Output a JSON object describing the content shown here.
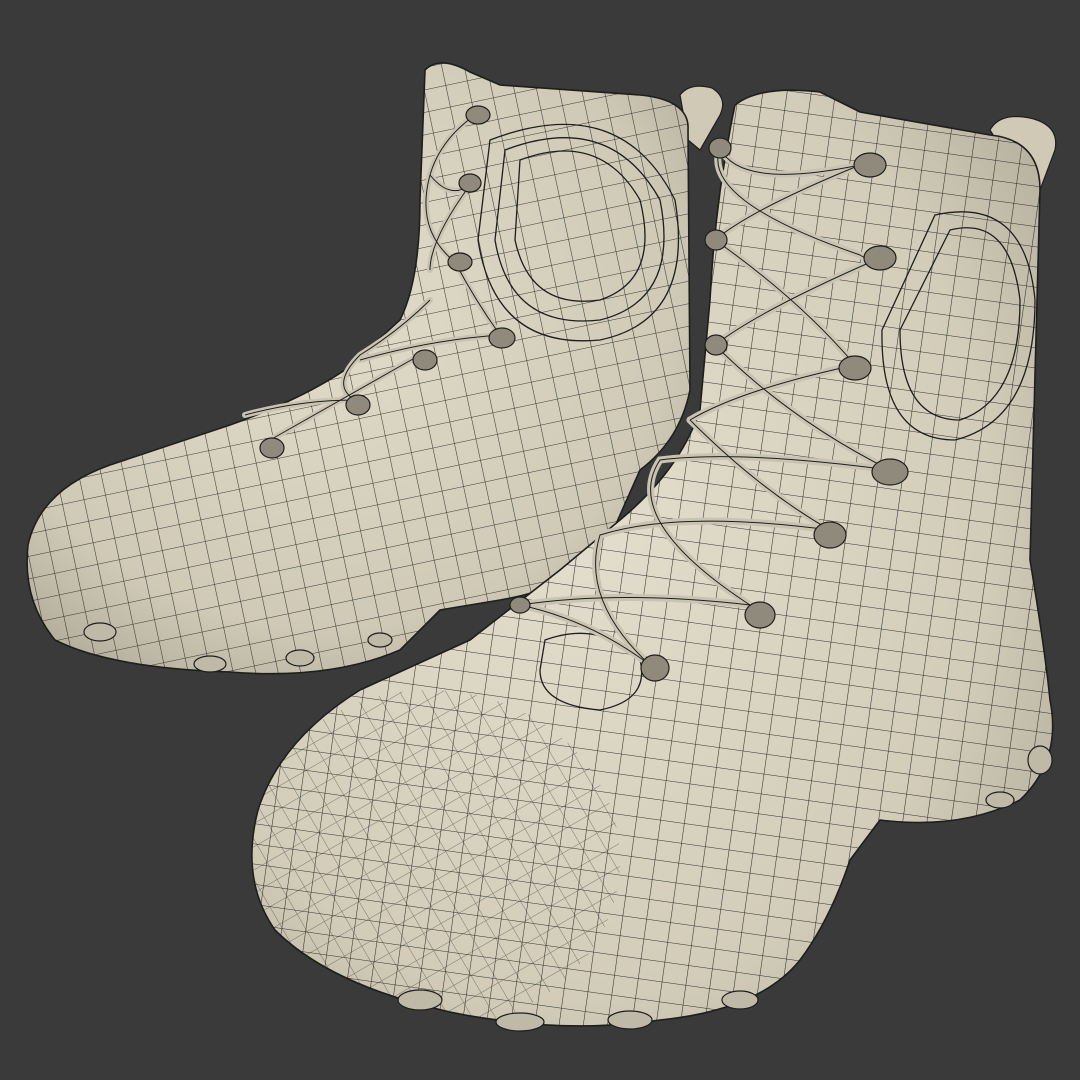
{
  "viewport": {
    "background": "#3a3a3a",
    "model_color": "#d6d1c0",
    "model_shade": "#a8a392",
    "wire_color": "#1e1e1c",
    "lace_color": "#c9c4b2"
  },
  "models": [
    {
      "name": "back-boot"
    },
    {
      "name": "front-boot"
    }
  ]
}
